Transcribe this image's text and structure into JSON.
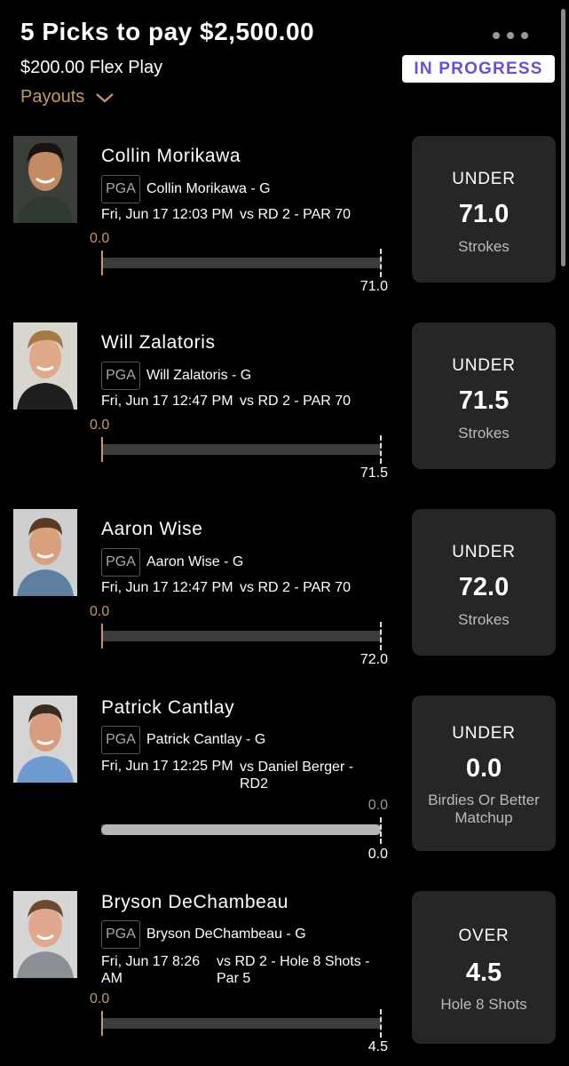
{
  "header": {
    "title": "5 Picks to pay $2,500.00",
    "subtitle": "$200.00 Flex Play",
    "status": "IN PROGRESS",
    "payouts_label": "Payouts"
  },
  "colors": {
    "background": "#000000",
    "accent_gold": "#c99a5e",
    "status_purple": "#6a4de0",
    "card_bg": "#262626"
  },
  "picks": [
    {
      "name": "Collin Morikawa",
      "league": "PGA",
      "desc": "Collin Morikawa - G",
      "when": "Fri, Jun 17 12:03 PM",
      "vs": "vs RD 2 - PAR 70",
      "current": "0.0",
      "target": "71.0",
      "progress": 0,
      "direction": "UNDER",
      "line": "71.0",
      "stat": "Strokes"
    },
    {
      "name": "Will Zalatoris",
      "league": "PGA",
      "desc": "Will Zalatoris - G",
      "when": "Fri, Jun 17 12:47 PM",
      "vs": "vs RD 2 - PAR 70",
      "current": "0.0",
      "target": "71.5",
      "progress": 0,
      "direction": "UNDER",
      "line": "71.5",
      "stat": "Strokes"
    },
    {
      "name": "Aaron Wise",
      "league": "PGA",
      "desc": "Aaron Wise - G",
      "when": "Fri, Jun 17 12:47 PM",
      "vs": "vs RD 2 - PAR 70",
      "current": "0.0",
      "target": "72.0",
      "progress": 0,
      "direction": "UNDER",
      "line": "72.0",
      "stat": "Strokes"
    },
    {
      "name": "Patrick Cantlay",
      "league": "PGA",
      "desc": "Patrick Cantlay - G",
      "when": "Fri, Jun 17 12:25 PM",
      "vs": "vs Daniel Berger - RD2",
      "current": "0.0",
      "opponent_value": "0.0",
      "target": "0.0",
      "progress": 1,
      "direction": "UNDER",
      "line": "0.0",
      "stat": "Birdies Or Better Matchup"
    },
    {
      "name": "Bryson DeChambeau",
      "league": "PGA",
      "desc": "Bryson DeChambeau - G",
      "when": "Fri, Jun 17 8:26 AM",
      "vs": "vs RD 2 - Hole 8 Shots - Par 5",
      "current": "0.0",
      "target": "4.5",
      "progress": 0,
      "direction": "OVER",
      "line": "4.5",
      "stat": "Hole 8 Shots"
    }
  ]
}
